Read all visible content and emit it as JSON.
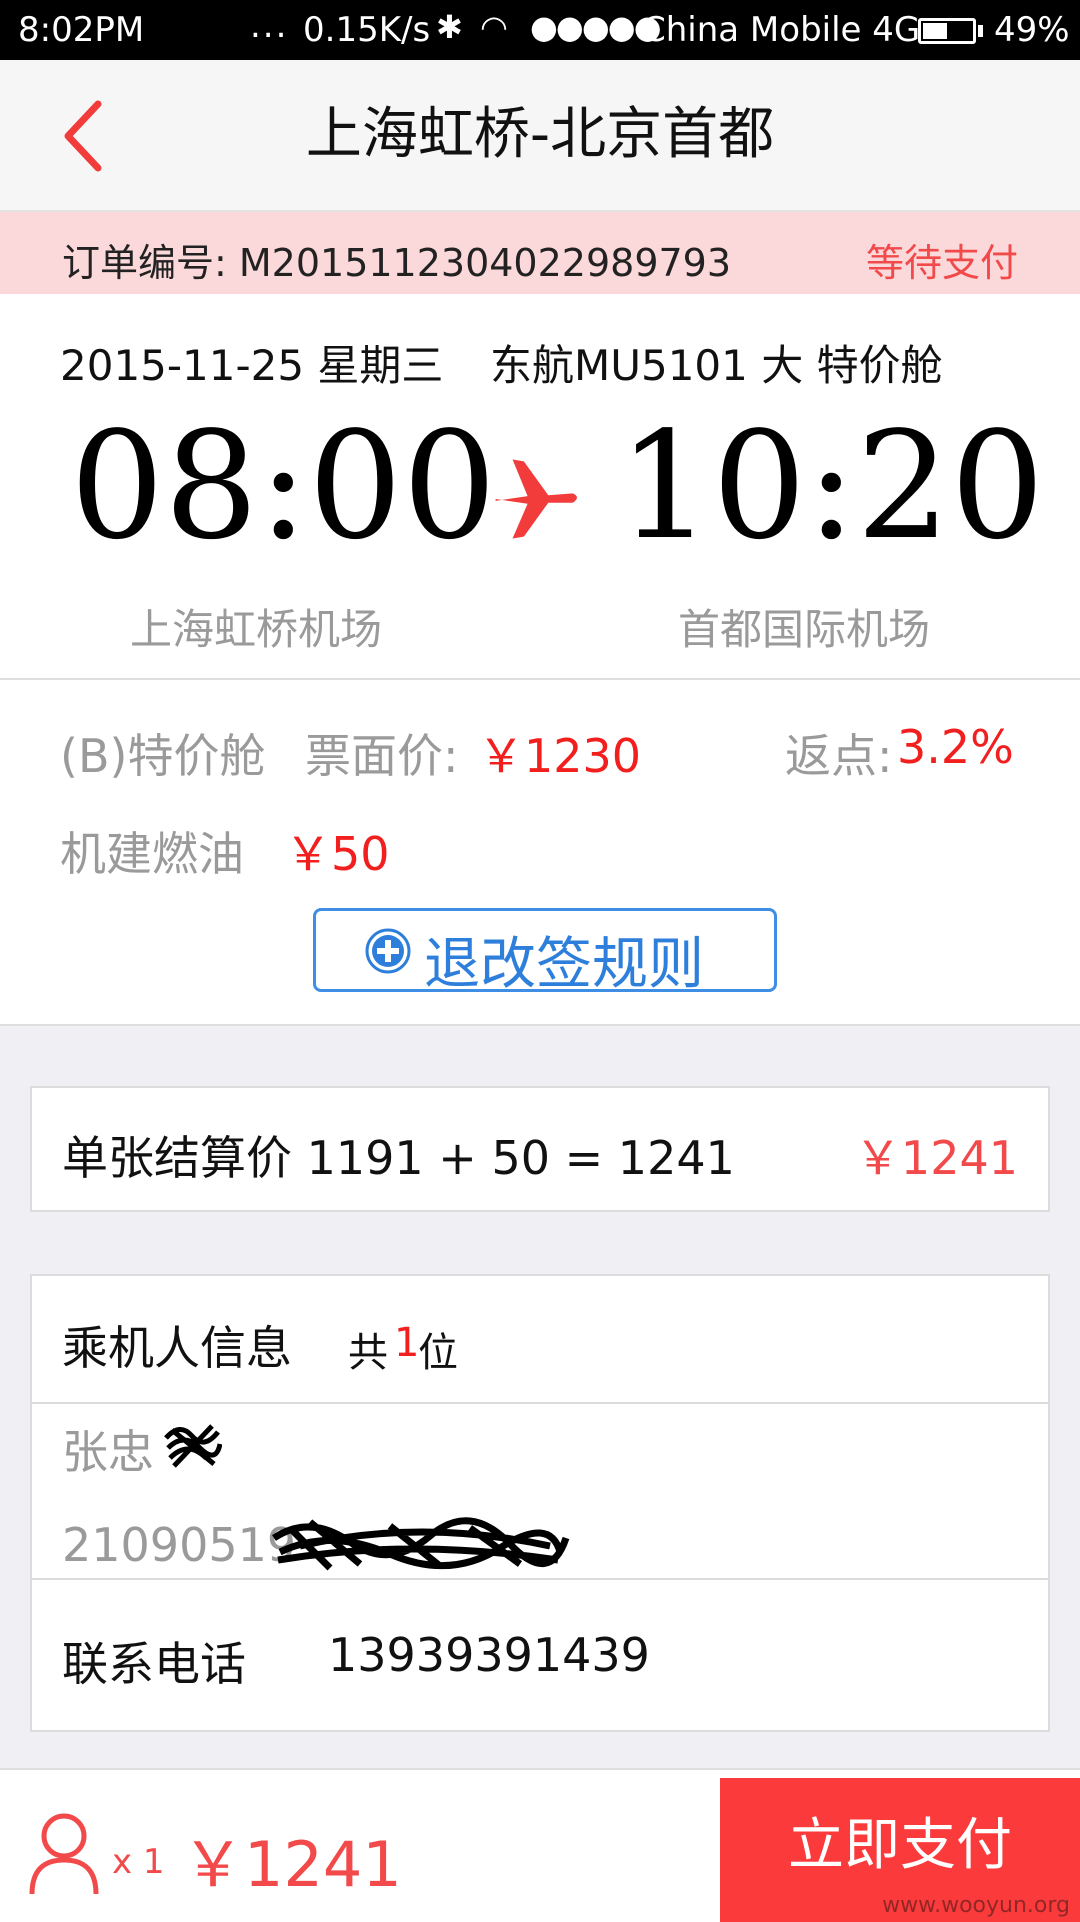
{
  "status_bar": {
    "time": "8:02PM",
    "activity": "...",
    "net_speed": "0.15K/s",
    "signal": "●●●●●",
    "carrier": "China Mobile 4G",
    "battery_percent": "49%",
    "battery_level": 0.49
  },
  "header": {
    "title": "上海虹桥-北京首都"
  },
  "order": {
    "label": "订单编号: M20151123040229897​93",
    "status": "等待支付"
  },
  "flight": {
    "date": "2015-11-25 星期三",
    "flight_no": "东航MU5101 大 特价舱",
    "dep_time": "08:00",
    "arr_time": "10:20",
    "dep_airport": "上海虹桥机场",
    "arr_airport": "首都国际机场"
  },
  "fare": {
    "cabin": "(B)特价舱",
    "price_label": "票面价:",
    "price_value": "￥1230",
    "rebate_label": "返点:",
    "rebate_value": "3.2%",
    "tax_label": "机建燃油",
    "tax_value": "￥50",
    "rules_button": "退改签规则"
  },
  "settle": {
    "label": "单张结算价 1191 + 50 = 1241",
    "value": "￥1241"
  },
  "passenger": {
    "title": "乘机人信息",
    "count_prefix": "共",
    "count": "1",
    "count_suffix": "位",
    "name": "张忠",
    "id_number": "21090519",
    "contact_label": "联系电话",
    "contact_value": "13939391439"
  },
  "bottom": {
    "qty": "x 1",
    "total": "￥1241",
    "pay_button": "立即支付",
    "watermark": "www.wooyun.org"
  },
  "colors": {
    "accent_red": "#fb3b3b",
    "price_red": "#f21f1f",
    "link_blue": "#2e7fdc",
    "order_bar_bg": "#fbd9da"
  },
  "icons": {
    "back": "chevron-left-icon",
    "plane": "plane-icon",
    "rules": "plus-circle-icon",
    "user": "user-icon"
  }
}
